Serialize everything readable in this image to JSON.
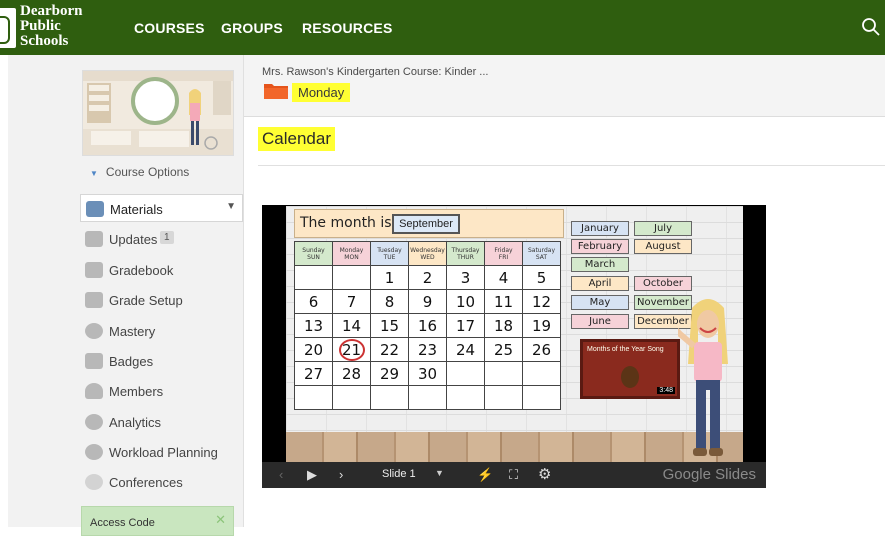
{
  "header": {
    "logo_lines": [
      "Dearborn",
      "Public",
      "Schools"
    ],
    "nav": [
      "COURSES",
      "GROUPS",
      "RESOURCES"
    ],
    "search_icon": "search-icon"
  },
  "sidebar": {
    "course_options": "Course Options",
    "items": [
      {
        "label": "Materials",
        "icon": "materials-icon",
        "active": true
      },
      {
        "label": "Updates",
        "icon": "updates-icon",
        "count": "1"
      },
      {
        "label": "Gradebook",
        "icon": "gradebook-icon"
      },
      {
        "label": "Grade Setup",
        "icon": "grade-setup-icon"
      },
      {
        "label": "Mastery",
        "icon": "mastery-icon"
      },
      {
        "label": "Badges",
        "icon": "badges-icon"
      },
      {
        "label": "Members",
        "icon": "members-icon"
      },
      {
        "label": "Analytics",
        "icon": "analytics-icon"
      },
      {
        "label": "Workload Planning",
        "icon": "workload-planning-icon"
      },
      {
        "label": "Conferences",
        "icon": "conferences-icon"
      }
    ],
    "access_code": "Access Code",
    "access_close": "✕"
  },
  "breadcrumb": {
    "course": "Mrs. Rawson's Kindergarten Course: Kinder ...",
    "folder": "Monday"
  },
  "page": {
    "title": "Calendar"
  },
  "slide": {
    "month_label": "The month is:",
    "month_value": "September",
    "days": [
      {
        "name": "Sunday",
        "abbr": "SUN",
        "color": "#d4e9cc"
      },
      {
        "name": "Monday",
        "abbr": "MON",
        "color": "#f6d2d8"
      },
      {
        "name": "Tuesday",
        "abbr": "TUE",
        "color": "#d7e3f3"
      },
      {
        "name": "Wednesday",
        "abbr": "WED",
        "color": "#fde7c6"
      },
      {
        "name": "Thursday",
        "abbr": "THUR",
        "color": "#d4e9cc"
      },
      {
        "name": "Friday",
        "abbr": "FRI",
        "color": "#f6d2d8"
      },
      {
        "name": "Saturday",
        "abbr": "SAT",
        "color": "#d7e3f3"
      }
    ],
    "weeks": [
      [
        "",
        "",
        "1",
        "2",
        "3",
        "4",
        "5"
      ],
      [
        "6",
        "7",
        "8",
        "9",
        "10",
        "11",
        "12"
      ],
      [
        "13",
        "14",
        "15",
        "16",
        "17",
        "18",
        "19"
      ],
      [
        "20",
        "21",
        "22",
        "23",
        "24",
        "25",
        "26"
      ],
      [
        "27",
        "28",
        "29",
        "30",
        "",
        "",
        ""
      ],
      [
        "",
        "",
        "",
        "",
        "",
        "",
        ""
      ]
    ],
    "circled_date": "21",
    "months": [
      {
        "label": "January",
        "color": "#d7e3f3"
      },
      {
        "label": "February",
        "color": "#f6d2d8"
      },
      {
        "label": "March",
        "color": "#d4e9cc"
      },
      {
        "label": "April",
        "color": "#fde7c6"
      },
      {
        "label": "May",
        "color": "#d7e3f3"
      },
      {
        "label": "June",
        "color": "#f6d2d8"
      },
      {
        "label": "July",
        "color": "#d4e9cc"
      },
      {
        "label": "August",
        "color": "#fde7c6"
      },
      {
        "label": "October",
        "color": "#f6d2d8"
      },
      {
        "label": "November",
        "color": "#d4e9cc"
      },
      {
        "label": "December",
        "color": "#fde7c6"
      }
    ],
    "video_title": "Months of the Year Song",
    "video_duration": "3:48"
  },
  "player": {
    "slide_label": "Slide 1",
    "brand": "Google Slides"
  }
}
